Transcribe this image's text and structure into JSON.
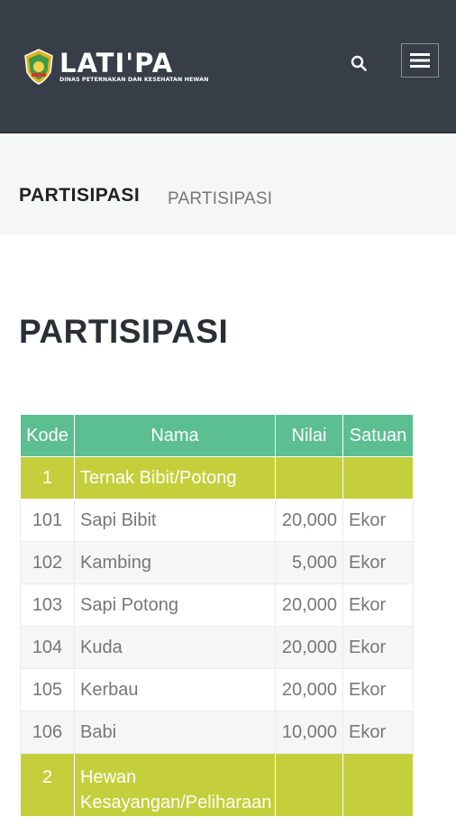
{
  "header": {
    "logo_title": "LATI'PA",
    "logo_subtitle": "DINAS PETERNAKAN DAN KESEHATAN HEWAN",
    "search_icon": "search-icon",
    "menu_icon": "hamburger-menu-icon",
    "background_color": "#373e47"
  },
  "breadcrumb": {
    "title": "PARTISIPASI",
    "current": "PARTISIPASI"
  },
  "page": {
    "title": "PARTISIPASI"
  },
  "table": {
    "header_color": "#5bbf92",
    "group_color": "#c5cf3b",
    "columns": [
      "Kode",
      "Nama",
      "Nilai",
      "Satuan"
    ],
    "rows": [
      {
        "kode": "1",
        "nama": "Ternak Bibit/Potong",
        "nilai": "",
        "satuan": "",
        "group": true
      },
      {
        "kode": "101",
        "nama": "Sapi Bibit",
        "nilai": "20,000",
        "satuan": "Ekor"
      },
      {
        "kode": "102",
        "nama": "Kambing",
        "nilai": "5,000",
        "satuan": "Ekor"
      },
      {
        "kode": "103",
        "nama": "Sapi Potong",
        "nilai": "20,000",
        "satuan": "Ekor"
      },
      {
        "kode": "104",
        "nama": "Kuda",
        "nilai": "20,000",
        "satuan": "Ekor"
      },
      {
        "kode": "105",
        "nama": "Kerbau",
        "nilai": "20,000",
        "satuan": "Ekor"
      },
      {
        "kode": "106",
        "nama": "Babi",
        "nilai": "10,000",
        "satuan": "Ekor"
      },
      {
        "kode": "2",
        "nama": "Hewan Kesayangan/Peliharaan",
        "nilai": "",
        "satuan": "",
        "group": true
      }
    ]
  }
}
